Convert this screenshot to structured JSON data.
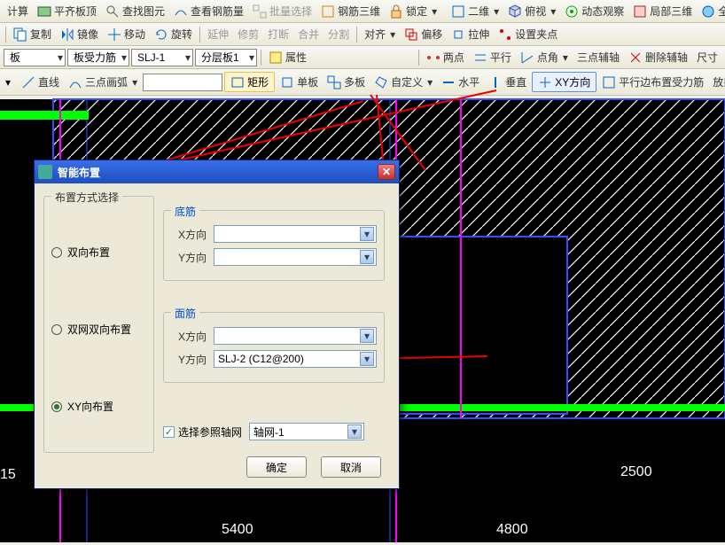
{
  "toolbars": {
    "r1": [
      "计算",
      "平齐板顶",
      "查找图元",
      "查看钢筋量",
      "批量选择",
      "钢筋三维",
      "锁定",
      "二维",
      "俯视",
      "动态观察",
      "局部三维",
      "全"
    ],
    "r2": [
      "复制",
      "镜像",
      "移动",
      "旋转",
      "延伸",
      "修剪",
      "打断",
      "合并",
      "分割",
      "对齐",
      "偏移",
      "拉伸",
      "设置夹点"
    ],
    "r3_dd": [
      "板",
      "板受力筋",
      "SLJ-1",
      "分层板1"
    ],
    "r3_prop": "属性",
    "r3_right": [
      "两点",
      "平行",
      "点角",
      "三点辅轴",
      "删除辅轴",
      "尺寸"
    ],
    "r4_left": [
      "直线",
      "三点画弧"
    ],
    "r4_mid": [
      "矩形",
      "单板",
      "多板",
      "自定义",
      "水平",
      "垂直",
      "XY方向",
      "平行边布置受力筋",
      "放射筋"
    ]
  },
  "dialog": {
    "title": "智能布置",
    "group_mode": "布置方式选择",
    "opt1": "双向布置",
    "opt2": "双网双向布置",
    "opt3": "XY向布置",
    "grp_bottom": "底筋",
    "grp_top": "面筋",
    "x_dir": "X方向",
    "y_dir": "Y方向",
    "top_y_val": "SLJ-2 (C12@200)",
    "chk_ref": "选择参照轴网",
    "ref_val": "轴网-1",
    "ok": "确定",
    "cancel": "取消"
  },
  "dims": {
    "d1": "5400",
    "d2": "4800",
    "d3": "2500",
    "d4": "15"
  }
}
